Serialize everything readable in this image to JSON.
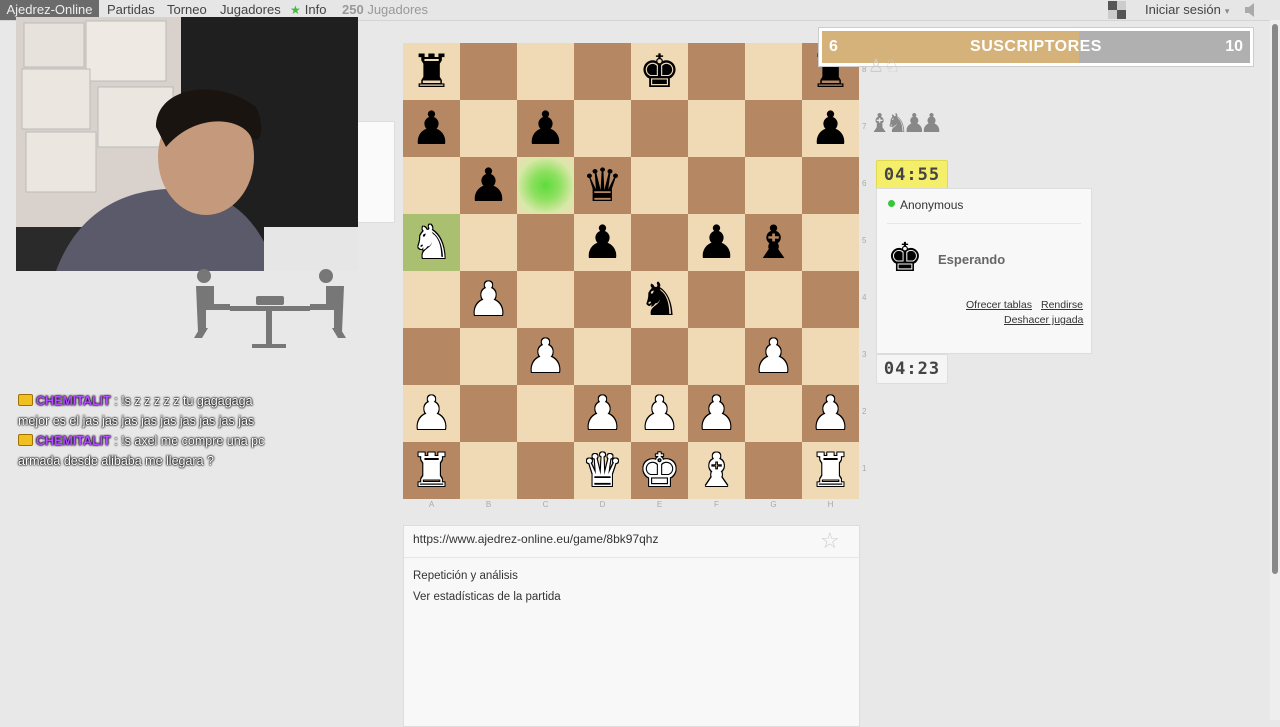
{
  "nav": {
    "brand": "Ajedrez-Online",
    "partidas": "Partidas",
    "torneo": "Torneo",
    "jugadores": "Jugadores",
    "info": "Info",
    "players_count": "250",
    "players_label": "Jugadores",
    "login": "Iniciar sesión"
  },
  "subscribers": {
    "low": "6",
    "title": "SUSCRIPTORES",
    "high": "10",
    "progress_fraction": 0.6
  },
  "chat": [
    {
      "user": "CHEMITALIT",
      "text": ": !s z z z z z tu gagagaga mejor es el jas jas jas jas jas jas jas jas jas"
    },
    {
      "user": "CHEMITALIT",
      "text": ": !s axel me compre una pc armada desde alibaba me llegara ?"
    }
  ],
  "board": {
    "files": [
      "A",
      "B",
      "C",
      "D",
      "E",
      "F",
      "G",
      "H"
    ],
    "ranks": [
      "8",
      "7",
      "6",
      "5",
      "4",
      "3",
      "2",
      "1"
    ],
    "pieces": [
      {
        "sq": "a8",
        "p": "♜",
        "c": "b"
      },
      {
        "sq": "e8",
        "p": "♚",
        "c": "b"
      },
      {
        "sq": "h8",
        "p": "♜",
        "c": "b"
      },
      {
        "sq": "a7",
        "p": "♟",
        "c": "b"
      },
      {
        "sq": "c7",
        "p": "♟",
        "c": "b"
      },
      {
        "sq": "h7",
        "p": "♟",
        "c": "b"
      },
      {
        "sq": "b6",
        "p": "♟",
        "c": "b"
      },
      {
        "sq": "d6",
        "p": "♛",
        "c": "b"
      },
      {
        "sq": "a5",
        "p": "♞",
        "c": "w"
      },
      {
        "sq": "d5",
        "p": "♟",
        "c": "b"
      },
      {
        "sq": "f5",
        "p": "♟",
        "c": "b"
      },
      {
        "sq": "g5",
        "p": "♝",
        "c": "b"
      },
      {
        "sq": "b4",
        "p": "♟",
        "c": "w"
      },
      {
        "sq": "e4",
        "p": "♞",
        "c": "b"
      },
      {
        "sq": "c3",
        "p": "♟",
        "c": "w"
      },
      {
        "sq": "g3",
        "p": "♟",
        "c": "w"
      },
      {
        "sq": "a2",
        "p": "♟",
        "c": "w"
      },
      {
        "sq": "d2",
        "p": "♟",
        "c": "w"
      },
      {
        "sq": "e2",
        "p": "♟",
        "c": "w"
      },
      {
        "sq": "f2",
        "p": "♟",
        "c": "w"
      },
      {
        "sq": "h2",
        "p": "♟",
        "c": "w"
      },
      {
        "sq": "a1",
        "p": "♜",
        "c": "w"
      },
      {
        "sq": "d1",
        "p": "♛",
        "c": "w"
      },
      {
        "sq": "e1",
        "p": "♚",
        "c": "w"
      },
      {
        "sq": "f1",
        "p": "♝",
        "c": "w"
      },
      {
        "sq": "h1",
        "p": "♜",
        "c": "w"
      }
    ],
    "highlights": {
      "c6": "hl-green",
      "a5": "hl-knight"
    }
  },
  "captured": {
    "top": "♙♘",
    "row": "♝♞♟♟"
  },
  "clocks": {
    "top": "04:55",
    "bottom": "04:23"
  },
  "opponent": {
    "name": "Anonymous",
    "status": "Esperando",
    "king": "♚"
  },
  "actions": {
    "offer_draw": "Ofrecer tablas",
    "resign": "Rendirse",
    "undo": "Deshacer jugada"
  },
  "game_panel": {
    "url": "https://www.ajedrez-online.eu/game/8bk97qhz",
    "fav_icon": "☆",
    "replay": "Repetición y análisis",
    "stats": "Ver estadísticas de la partida"
  },
  "icons": {
    "info": "★",
    "caret": "▾",
    "sound": "◀"
  }
}
